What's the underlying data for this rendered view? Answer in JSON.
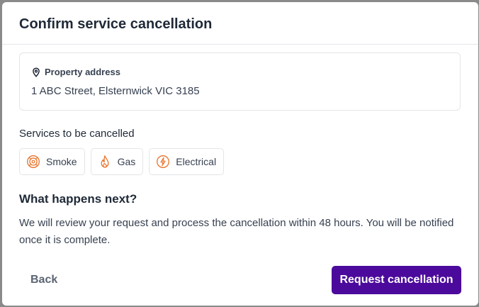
{
  "dialog": {
    "title": "Confirm service cancellation"
  },
  "property": {
    "label": "Property address",
    "icon": "map-pin-icon",
    "address": "1 ABC Street, Elsternwick VIC 3185"
  },
  "services": {
    "heading": "Services to be cancelled",
    "items": [
      {
        "label": "Smoke",
        "icon": "smoke-alarm-icon"
      },
      {
        "label": "Gas",
        "icon": "flame-icon"
      },
      {
        "label": "Electrical",
        "icon": "lightning-icon"
      }
    ]
  },
  "next_steps": {
    "heading": "What happens next?",
    "body": "We will review your request and process the cancellation within 48 hours. You will be notified once it is complete."
  },
  "actions": {
    "back_label": "Back",
    "request_label": "Request cancellation"
  },
  "colors": {
    "primary": "#4c0a9c",
    "icon_accent": "#e8732a",
    "text": "#374151"
  }
}
